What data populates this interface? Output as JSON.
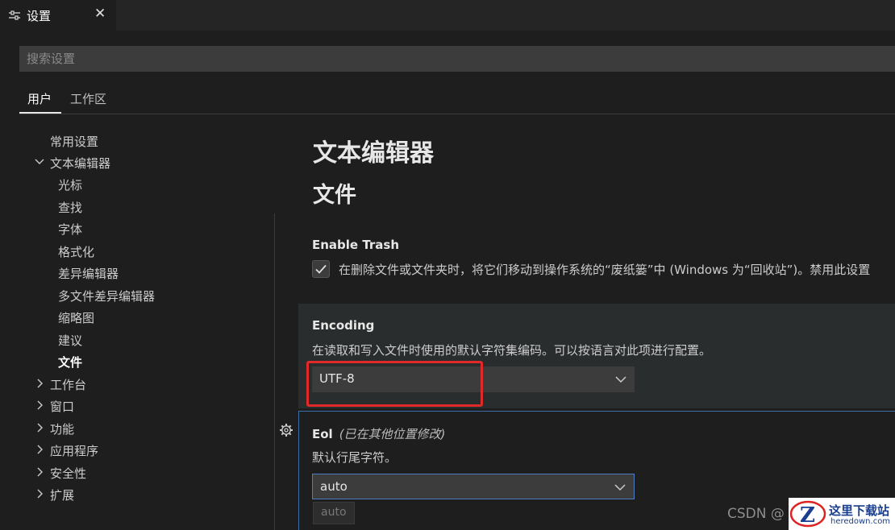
{
  "tab": {
    "title": "设置",
    "close": "✕"
  },
  "search": {
    "placeholder": "搜索设置"
  },
  "scope": {
    "user": "用户",
    "workspace": "工作区"
  },
  "toc": {
    "common": "常用设置",
    "text_editor": "文本编辑器",
    "children": [
      "光标",
      "查找",
      "字体",
      "格式化",
      "差异编辑器",
      "多文件差异编辑器",
      "缩略图",
      "建议",
      "文件"
    ],
    "collapsed": [
      "工作台",
      "窗口",
      "功能",
      "应用程序",
      "安全性",
      "扩展"
    ]
  },
  "content": {
    "section_title": "文本编辑器",
    "subsection_title": "文件",
    "enable_trash": {
      "title": "Enable Trash",
      "checked": true,
      "description": "在删除文件或文件夹时，将它们移动到操作系统的“废纸篓”中 (Windows 为“回收站”)。禁用此设置"
    },
    "encoding": {
      "title": "Encoding",
      "description": "在读取和写入文件时使用的默认字符集编码。可以按语言对此项进行配置。",
      "value": "UTF-8"
    },
    "eol": {
      "title": "Eol",
      "modified_note": "(已在其他位置修改)",
      "description": "默认行尾字符。",
      "value": "auto",
      "option": "auto"
    }
  },
  "watermark": {
    "text": "CSDN @",
    "brand": "这里下载站",
    "domain": "heredown.com"
  },
  "colors": {
    "background": "#1e1e1e",
    "input": "#3c3c3c",
    "focus_border": "#4d7cc2",
    "annotation_red": "#e02a2a"
  }
}
